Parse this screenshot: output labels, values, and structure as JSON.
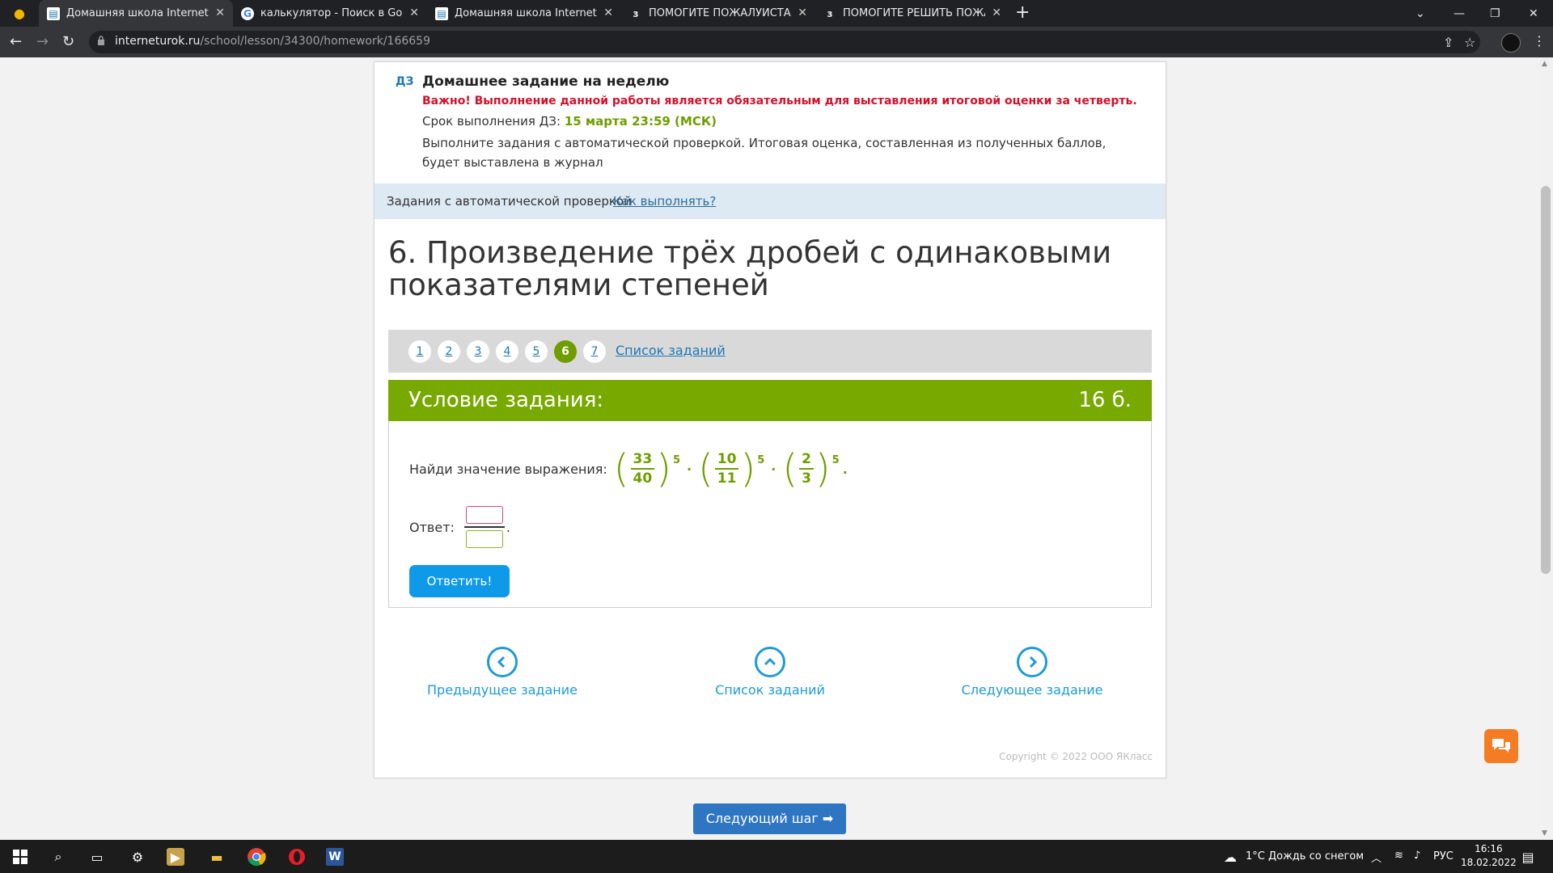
{
  "browser": {
    "tabs": [
      {
        "title": "Домашняя школа InternetUrok.r",
        "icon": "internet-urok-favicon",
        "active": true
      },
      {
        "title": "калькулятор - Поиск в Google",
        "icon": "google-favicon",
        "active": false
      },
      {
        "title": "Домашняя школа InternetUrok.r",
        "icon": "internet-urok-favicon",
        "active": false
      },
      {
        "title": "ПОМОГИТЕ ПОЖАЛУЙСТА ДАЮ",
        "icon": "znanija-favicon",
        "active": false
      },
      {
        "title": "ПОМОГИТЕ РЕШИТЬ ПОЖАЛУЙ",
        "icon": "znanija-favicon",
        "active": false
      }
    ],
    "url_host": "interneturok.ru",
    "url_path": "/school/lesson/34300/homework/166659"
  },
  "homework": {
    "badge": "ДЗ",
    "title": "Домашнее задание на неделю",
    "important": "Важно! Выполнение данной работы является обязательным для выставления итоговой оценки за четверть.",
    "deadline_label": "Срок выполнения ДЗ:",
    "deadline_value": "15 марта 23:59 (МСК)",
    "description": "Выполните задания с автоматической проверкой. Итоговая оценка, составленная из полученных баллов, будет выставлена в журнал"
  },
  "autocheck": {
    "label": "Задания с автоматической проверкой",
    "how_link": "Как выполнять?"
  },
  "task": {
    "title": "6. Произведение трёх дробей с одинаковыми показателями степеней",
    "pages": [
      "1",
      "2",
      "3",
      "4",
      "5",
      "6",
      "7"
    ],
    "active_page": "6",
    "list_link": "Список заданий",
    "condition_label": "Условие задания:",
    "points": "16 б.",
    "prompt": "Найди значение выражения:",
    "fractions": [
      {
        "num": "33",
        "den": "40",
        "pow": "5"
      },
      {
        "num": "10",
        "den": "11",
        "pow": "5"
      },
      {
        "num": "2",
        "den": "3",
        "pow": "5"
      }
    ],
    "answer_label": "Ответ:",
    "submit_label": "Ответить!"
  },
  "navigation": {
    "prev": "Предыдущее задание",
    "list": "Список заданий",
    "next": "Следующее задание"
  },
  "copyright": "Copyright © 2022 ООО ЯКласс",
  "next_step": "Следующий шаг",
  "taskbar": {
    "weather": "1°C  Дождь со снегом",
    "lang": "РУС",
    "time": "16:16",
    "date": "18.02.2022"
  },
  "colors": {
    "accent_green": "#78a900",
    "link_blue": "#1e78b4",
    "important_red": "#d0112b",
    "submit_blue": "#0e9ae8"
  }
}
